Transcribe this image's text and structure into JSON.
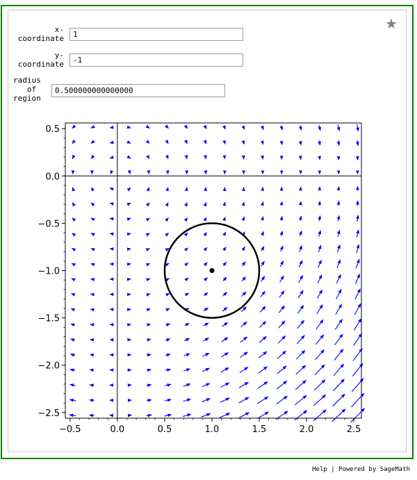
{
  "inputs": {
    "x_label": "x-\ncoordinate",
    "x_value": "1",
    "y_label": "y-\ncoordinate",
    "y_value": "-1",
    "r_label": "radius\n   of\nregion",
    "r_value": "0.500000000000000"
  },
  "star_icon": "star-icon",
  "footer": {
    "help": "Help",
    "sep": " | ",
    "powered": "Powered by SageMath"
  },
  "colors": {
    "frame": "#008000",
    "arrows": "#0000ff",
    "circle": "#000000"
  },
  "chart_data": {
    "type": "vector-field",
    "xlim": [
      -0.55,
      2.58
    ],
    "ylim": [
      -2.56,
      0.56
    ],
    "x_ticks": [
      -0.5,
      0.0,
      0.5,
      1.0,
      1.5,
      2.0,
      2.5
    ],
    "x_tick_labels": [
      "−0.5",
      "0.0",
      "0.5",
      "1.0",
      "1.5",
      "2.0",
      "2.5"
    ],
    "y_ticks": [
      0.5,
      0.0,
      -0.5,
      -1.0,
      -1.5,
      -2.0,
      -2.5
    ],
    "y_tick_labels": [
      "0.5",
      "0.0",
      "−0.5",
      "−1.0",
      "−1.5",
      "−2.0",
      "−2.5"
    ],
    "field": "F(x,y) = (x·y², −y·x²) shape, arrows normalized by max magnitude",
    "grid_nx": 16,
    "grid_ny": 20,
    "point": {
      "x": 1,
      "y": -1
    },
    "circle": {
      "cx": 1,
      "cy": -1,
      "r": 0.5
    },
    "axes_lines": true,
    "grid": false
  }
}
